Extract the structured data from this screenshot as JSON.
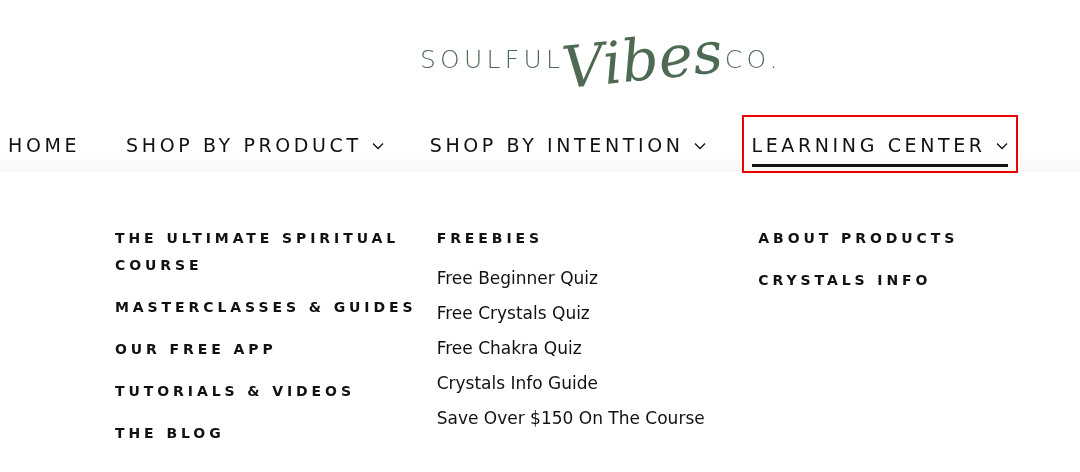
{
  "logo": {
    "left": "SOULFUL",
    "script": "Vibes",
    "right": "CO."
  },
  "nav": [
    {
      "label": "HOME",
      "has_caret": false,
      "selected": false,
      "highlighted": false
    },
    {
      "label": "SHOP BY PRODUCT",
      "has_caret": true,
      "selected": false,
      "highlighted": false
    },
    {
      "label": "SHOP BY INTENTION",
      "has_caret": true,
      "selected": false,
      "highlighted": false
    },
    {
      "label": "LEARNING CENTER",
      "has_caret": true,
      "selected": true,
      "highlighted": true
    }
  ],
  "mega_menu": [
    {
      "items": [
        {
          "kind": "heading",
          "text": "THE ULTIMATE SPIRITUAL COURSE"
        },
        {
          "kind": "heading",
          "text": "MASTERCLASSES & GUIDES"
        },
        {
          "kind": "heading",
          "text": "OUR FREE APP"
        },
        {
          "kind": "heading",
          "text": "TUTORIALS & VIDEOS"
        },
        {
          "kind": "heading",
          "text": "THE BLOG"
        }
      ]
    },
    {
      "items": [
        {
          "kind": "heading",
          "text": "FREEBIES"
        },
        {
          "kind": "link",
          "text": "Free Beginner Quiz"
        },
        {
          "kind": "link",
          "text": "Free Crystals Quiz"
        },
        {
          "kind": "link",
          "text": "Free Chakra Quiz"
        },
        {
          "kind": "link",
          "text": "Crystals Info Guide"
        },
        {
          "kind": "link",
          "text": "Save Over $150 On The Course"
        }
      ]
    },
    {
      "items": [
        {
          "kind": "heading",
          "text": "ABOUT PRODUCTS"
        },
        {
          "kind": "heading",
          "text": "CRYSTALS INFO"
        }
      ]
    }
  ]
}
